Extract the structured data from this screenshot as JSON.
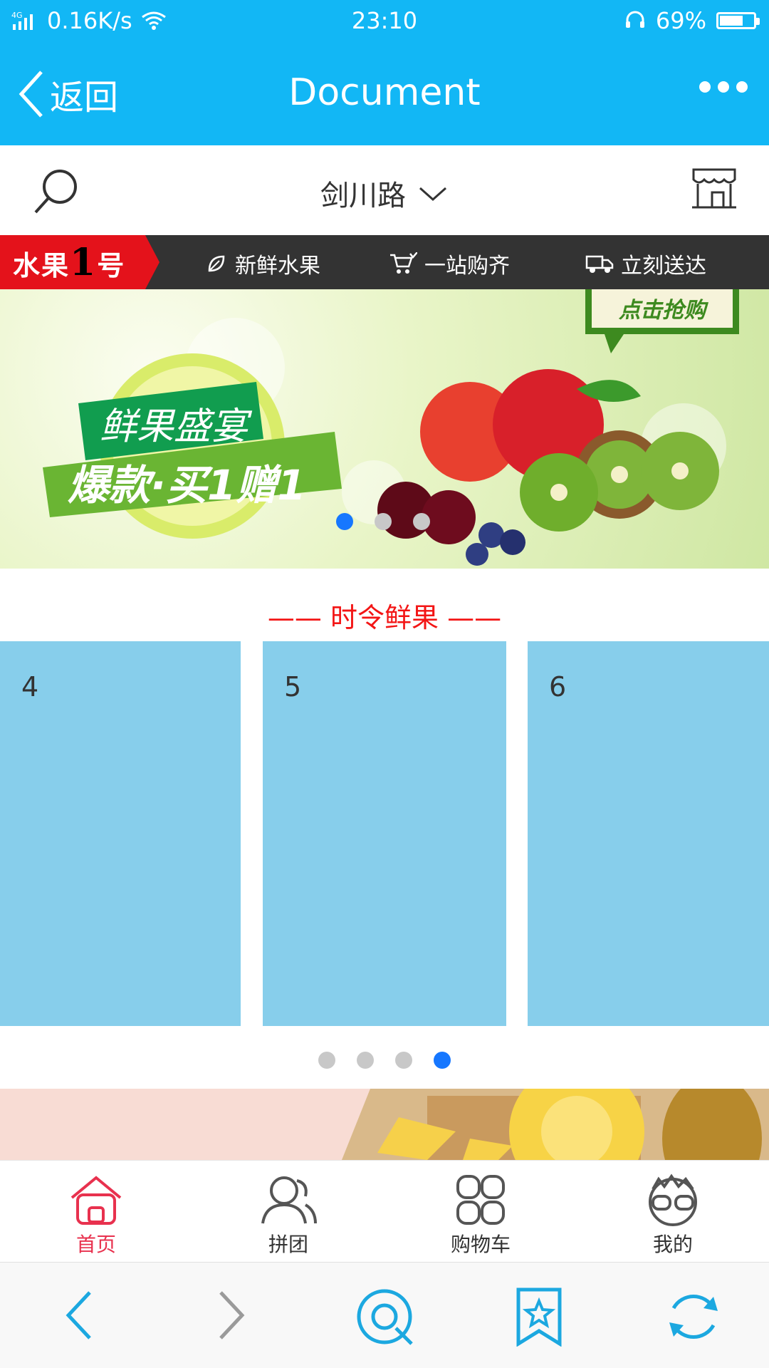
{
  "status_bar": {
    "signal": "4G",
    "net_speed": "0.16K/s",
    "time": "23:10",
    "battery_text": "69%",
    "battery_level": 0.69
  },
  "nav": {
    "back_label": "返回",
    "title": "Document"
  },
  "location": {
    "address": "剑川路"
  },
  "promo_strip": {
    "brand_prefix": "水果",
    "brand_num": "1",
    "brand_suffix": "号",
    "features": [
      "新鲜水果",
      "一站购齐",
      "立刻送达"
    ]
  },
  "hero": {
    "cta": "点击抢购",
    "headline": "鲜果盛宴",
    "subheadline": "爆款·买1赠1",
    "dots_total": 3,
    "active_dot": 0
  },
  "section": {
    "title": "—— 时令鲜果 ——",
    "cards": [
      "4",
      "5",
      "6"
    ],
    "dots_total": 4,
    "active_dot": 3
  },
  "tabs": [
    {
      "label": "首页",
      "icon": "home-icon",
      "active": true
    },
    {
      "label": "拼团",
      "icon": "group-icon",
      "active": false
    },
    {
      "label": "购物车",
      "icon": "cart-grid-icon",
      "active": false
    },
    {
      "label": "我的",
      "icon": "profile-icon",
      "active": false
    }
  ],
  "colors": {
    "header": "#12b7f5",
    "accent_red": "#f31515",
    "card": "#87ceeb",
    "tab_active": "#e8314e",
    "dot_active": "#1677ff"
  }
}
